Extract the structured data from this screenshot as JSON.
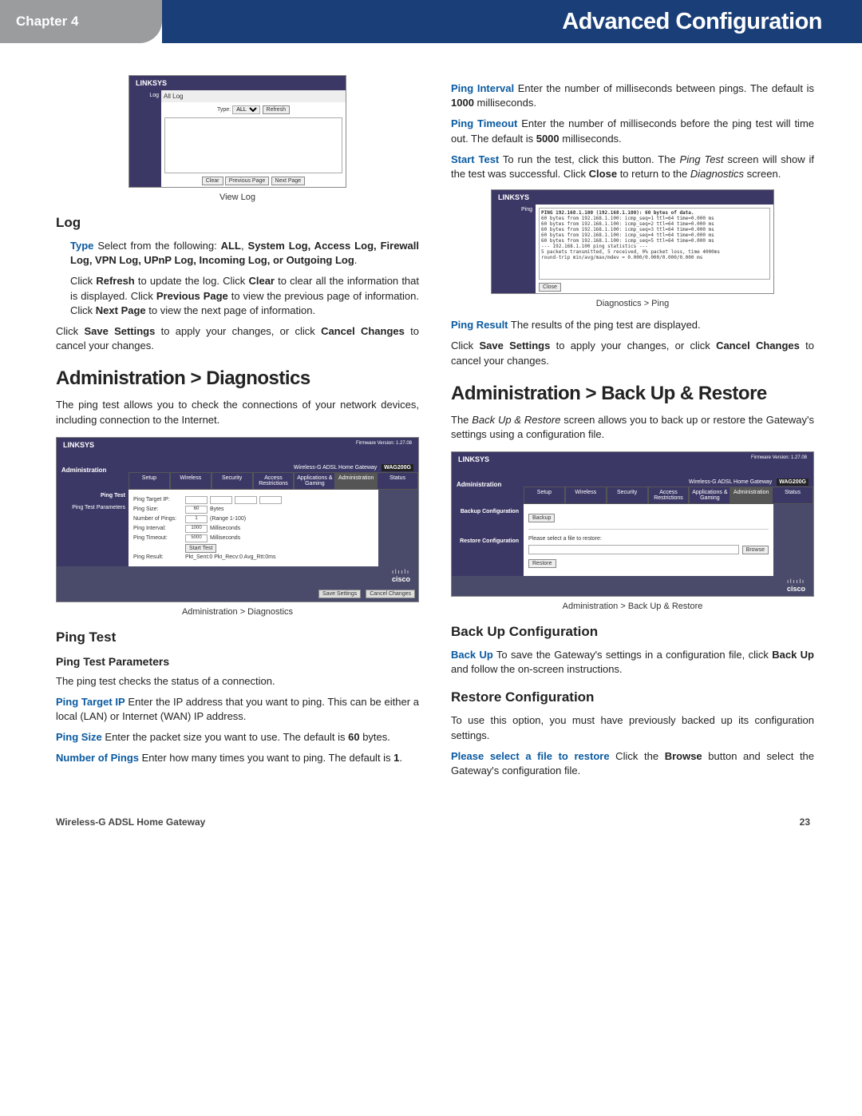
{
  "header": {
    "chapter": "Chapter 4",
    "title": "Advanced Configuration"
  },
  "left": {
    "fig1_caption": "View Log",
    "fig1": {
      "brand": "LINKSYS",
      "tab": "Log",
      "panel": "All Log",
      "type_lbl": "Type:",
      "type_val": "ALL",
      "btn_refresh": "Refresh",
      "btn_clear": "Clear",
      "btn_prev": "Previous Page",
      "btn_next": "Next Page"
    },
    "log_h": "Log",
    "log_p1_type": "Type",
    "log_p1_a": "  Select from the following: ",
    "log_p1_b": "ALL",
    "log_p1_c": ", ",
    "log_p1_d": "System Log, Access Log, Firewall Log,  VPN Log, UPnP Log, Incoming Log, or Outgoing Log",
    "log_p1_e": ".",
    "log_p2_a": "Click ",
    "log_p2_b": "Refresh",
    "log_p2_c": " to update the log. Click ",
    "log_p2_d": "Clear",
    "log_p2_e": " to clear all the information that is displayed. Click ",
    "log_p2_f": "Previous Page",
    "log_p2_g": " to view the previous page of information. Click ",
    "log_p2_h": "Next Page",
    "log_p2_i": " to view the next page of information.",
    "log_p3_a": "Click ",
    "log_p3_b": "Save Settings",
    "log_p3_c": " to apply your changes, or click ",
    "log_p3_d": "Cancel Changes",
    "log_p3_e": " to cancel your changes.",
    "diag_h": "Administration > Diagnostics",
    "diag_p": "The ping test allows you to check the connections of your network devices, including connection to the Internet.",
    "fig2_caption": "Administration > Diagnostics",
    "fig2": {
      "brand": "LINKSYS",
      "firmware": "Firmware Version: 1.27.08",
      "model_lbl": "Wireless-G ADSL Home Gateway",
      "model": "WAG200G",
      "admin": "Administration",
      "tabs": [
        "Setup",
        "Wireless",
        "Security",
        "Access Restrictions",
        "Applications & Gaming",
        "Administration",
        "Status"
      ],
      "side1": "Ping Test",
      "side2": "Ping Test Parameters",
      "r1": "Ping Target IP:",
      "r2": "Ping Size:",
      "r2b": "Bytes",
      "r2v": "60",
      "r3": "Number of Pings:",
      "r3b": "(Range 1-100)",
      "r3v": "1",
      "r4": "Ping Interval:",
      "r4b": "Milliseconds",
      "r4v": "1000",
      "r5": "Ping Timeout:",
      "r5b": "Milliseconds",
      "r5v": "5000",
      "btn_start": "Start Test",
      "r6": "Ping Result:",
      "r6v": "Pkt_Sent:0 Pkt_Recv:0 Avg_Rtt:0ms",
      "save": "Save Settings",
      "cancel": "Cancel Changes",
      "cisco": "cisco"
    },
    "ping_h": "Ping Test",
    "ping_params_h": "Ping Test Parameters",
    "ping_p1": "The ping test checks the status of a connection.",
    "ping_t1": "Ping Target IP",
    "ping_t1_a": "  Enter the IP address that you want to ping. This can be either a local (LAN) or Internet (WAN) IP address.",
    "ping_t2": "Ping Size",
    "ping_t2_a": "  Enter the packet size you want to use. The default is ",
    "ping_t2_b": "60",
    "ping_t2_c": " bytes.",
    "ping_t3": "Number of Pings",
    "ping_t3_a": "  Enter how many times you want to ping. The default is ",
    "ping_t3_b": "1",
    "ping_t3_c": "."
  },
  "right": {
    "r_t1": "Ping Interval",
    "r_t1_a": "  Enter the number of milliseconds between pings. The default is ",
    "r_t1_b": "1000",
    "r_t1_c": " milliseconds.",
    "r_t2": "Ping Timeout",
    "r_t2_a": "  Enter the number of milliseconds before the ping test will time out. The default is ",
    "r_t2_b": "5000",
    "r_t2_c": " milliseconds.",
    "r_t3": "Start Test",
    "r_t3_a": "  To run the test, click this button. The ",
    "r_t3_b": "Ping Test",
    "r_t3_c": " screen will show if the test was successful. Click ",
    "r_t3_d": "Close",
    "r_t3_e": " to return to the ",
    "r_t3_f": "Diagnostics",
    "r_t3_g": " screen.",
    "fig3_caption": "Diagnostics > Ping",
    "fig3": {
      "brand": "LINKSYS",
      "tab": "Ping",
      "line1": "PING 192.168.1.100 (192.168.1.100): 60 bytes of data.",
      "lines": "60 bytes from 192.168.1.100: icmp_seq=1 ttl=64 time=0.000 ms\n60 bytes from 192.168.1.100: icmp_seq=2 ttl=64 time=0.000 ms\n60 bytes from 192.168.1.100: icmp_seq=3 ttl=64 time=0.000 ms\n60 bytes from 192.168.1.100: icmp_seq=4 ttl=64 time=0.000 ms\n60 bytes from 192.168.1.100: icmp_seq=5 ttl=64 time=0.000 ms\n--- 192.168.1.100 ping statistics ---\n5 packets transmitted, 5 received, 0% packet loss, time 4000ms\nround-trip min/avg/max/mdev = 0.000/0.000/0.000/0.000 ms",
      "close": "Close"
    },
    "r_t4": "Ping Result",
    "r_t4_a": "  The results of the ping test are displayed.",
    "r_p2_a": "Click ",
    "r_p2_b": "Save Settings",
    "r_p2_c": " to apply your changes, or click ",
    "r_p2_d": "Cancel Changes",
    "r_p2_e": " to cancel your changes.",
    "backup_h": "Administration > Back Up & Restore",
    "backup_p_a": "The ",
    "backup_p_b": "Back Up & Restore",
    "backup_p_c": " screen allows you to back up or restore the Gateway's settings using a configuration file.",
    "fig4_caption": "Administration > Back Up & Restore",
    "fig4": {
      "brand": "LINKSYS",
      "firmware": "Firmware Version: 1.27.08",
      "model_lbl": "Wireless-G ADSL Home Gateway",
      "model": "WAG200G",
      "admin": "Administration",
      "tabs": [
        "Setup",
        "Wireless",
        "Security",
        "Access Restrictions",
        "Applications & Gaming",
        "Administration",
        "Status"
      ],
      "side1": "Backup Configuration",
      "btn1": "Backup",
      "side2": "Restore Configuration",
      "lbl2": "Please select a file to restore:",
      "btn_browse": "Browse",
      "btn_restore": "Restore",
      "cisco": "cisco"
    },
    "buc_h": "Back Up Configuration",
    "buc_t": "Back Up",
    "buc_a": "  To save the Gateway's settings in a configuration file, click ",
    "buc_b": "Back Up",
    "buc_c": " and follow the on-screen instructions.",
    "rc_h": "Restore Configuration",
    "rc_p": "To use this option, you must have previously backed up its configuration settings.",
    "rc_t": "Please select a file to restore",
    "rc_a": "  Click the ",
    "rc_b": "Browse",
    "rc_c": " button and select the Gateway's configuration file."
  },
  "footer": {
    "left": "Wireless-G ADSL Home Gateway",
    "right": "23"
  }
}
